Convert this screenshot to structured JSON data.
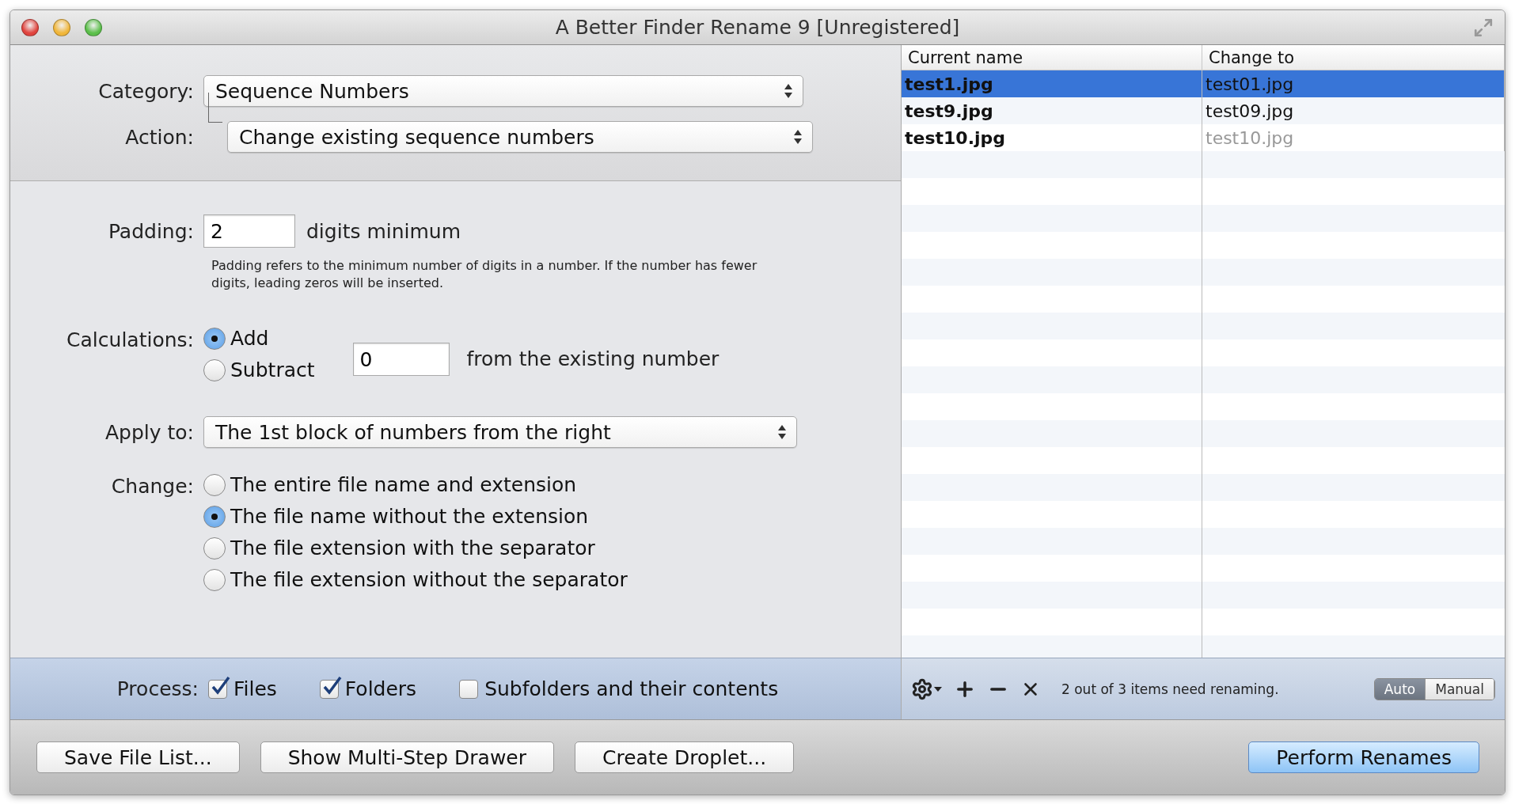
{
  "window": {
    "title": "A Better Finder Rename 9 [Unregistered]"
  },
  "category": {
    "label": "Category:",
    "value": "Sequence Numbers"
  },
  "action": {
    "label": "Action:",
    "value": "Change existing sequence numbers"
  },
  "padding": {
    "label": "Padding:",
    "value": "2",
    "suffix": "digits minimum",
    "help": "Padding refers to the minimum number of digits in a number. If the number has fewer digits, leading zeros will be inserted."
  },
  "calculations": {
    "label": "Calculations:",
    "options": [
      {
        "label": "Add",
        "selected": true
      },
      {
        "label": "Subtract",
        "selected": false
      }
    ],
    "value": "0",
    "suffix": "from the existing number"
  },
  "apply_to": {
    "label": "Apply to:",
    "value": "The 1st block of numbers from the right"
  },
  "change": {
    "label": "Change:",
    "options": [
      {
        "label": "The entire file name and extension",
        "selected": false
      },
      {
        "label": "The file name without the extension",
        "selected": true
      },
      {
        "label": "The file extension with the separator",
        "selected": false
      },
      {
        "label": "The file extension without the separator",
        "selected": false
      }
    ]
  },
  "process": {
    "label": "Process:",
    "options": [
      {
        "label": "Files",
        "checked": true
      },
      {
        "label": "Folders",
        "checked": true
      },
      {
        "label": "Subfolders and their contents",
        "checked": false
      }
    ]
  },
  "table": {
    "columns": [
      "Current name",
      "Change to"
    ],
    "rows": [
      {
        "current": "test1.jpg",
        "change_to": "test01.jpg",
        "selected": true,
        "unchanged": false
      },
      {
        "current": "test9.jpg",
        "change_to": "test09.jpg",
        "selected": false,
        "unchanged": false
      },
      {
        "current": "test10.jpg",
        "change_to": "test10.jpg",
        "selected": false,
        "unchanged": true
      }
    ]
  },
  "table_footer": {
    "status": "2 out of 3 items need renaming.",
    "modes": [
      {
        "label": "Auto",
        "selected": true
      },
      {
        "label": "Manual",
        "selected": false
      }
    ]
  },
  "buttons": [
    {
      "label": "Save File List...",
      "kind": "normal"
    },
    {
      "label": "Show Multi-Step Drawer",
      "kind": "normal"
    },
    {
      "label": "Create Droplet...",
      "kind": "normal"
    },
    {
      "label": "Perform Renames",
      "kind": "default"
    }
  ]
}
